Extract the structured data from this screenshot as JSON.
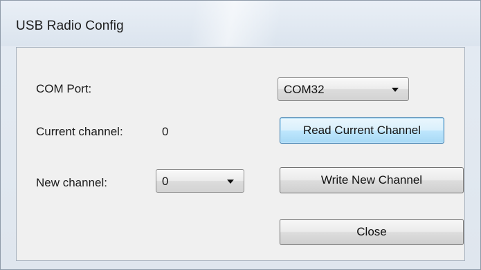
{
  "window": {
    "title": "USB Radio Config"
  },
  "form": {
    "com_port_label": "COM Port:",
    "com_port_value": "COM32",
    "current_channel_label": "Current channel:",
    "current_channel_value": "0",
    "new_channel_label": "New channel:",
    "new_channel_value": "0"
  },
  "buttons": {
    "read_label": "Read Current Channel",
    "write_label": "Write New Channel",
    "close_label": "Close"
  },
  "icons": {
    "dropdown": "chevron-down-icon"
  },
  "colors": {
    "focus_border": "#3c7fb1",
    "client_bg": "#f0f0f0"
  }
}
